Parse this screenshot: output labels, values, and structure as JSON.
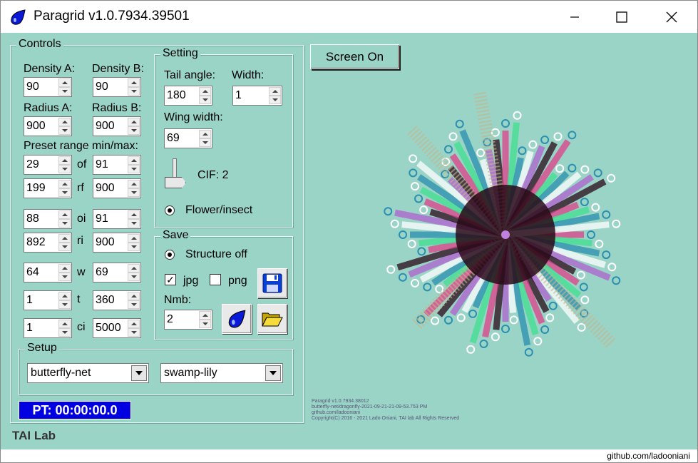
{
  "window": {
    "title": "Paragrid v1.0.7934.39501",
    "min_icon": "minimize-icon",
    "max_icon": "maximize-icon",
    "close_icon": "close-icon"
  },
  "controls": {
    "title": "Controls",
    "density_a_label": "Density A:",
    "density_b_label": "Density B:",
    "density_a": "90",
    "density_b": "90",
    "radius_a_label": "Radius A:",
    "radius_b_label": "Radius B:",
    "radius_a": "900",
    "radius_b": "900",
    "preset_label": "Preset range min/max:",
    "rows": [
      {
        "min": "29",
        "tag": "of",
        "max": "91"
      },
      {
        "min": "199",
        "tag": "rf",
        "max": "900"
      },
      {
        "min": "88",
        "tag": "oi",
        "max": "91"
      },
      {
        "min": "892",
        "tag": "ri",
        "max": "900"
      },
      {
        "min": "64",
        "tag": "w",
        "max": "69"
      },
      {
        "min": "1",
        "tag": "t",
        "max": "360"
      },
      {
        "min": "1",
        "tag": "ci",
        "max": "5000"
      }
    ]
  },
  "setting": {
    "title": "Setting",
    "tail_angle_label": "Tail angle:",
    "tail_angle": "180",
    "width_label": "Width:",
    "width": "1",
    "wing_width_label": "Wing width:",
    "wing_width": "69",
    "cif_label": "CIF: 2",
    "radio_label": "Flower/insect"
  },
  "save": {
    "title": "Save",
    "structure_label": "Structure off",
    "jpg_label": "jpg",
    "jpg_checked": true,
    "png_label": "png",
    "png_checked": false,
    "nmb_label": "Nmb:",
    "nmb": "2",
    "save_icon": "floppy-disk-icon",
    "drop_icon": "blue-drop-icon",
    "folder_icon": "open-folder-icon"
  },
  "setup": {
    "title": "Setup",
    "combo1": "butterfly-net",
    "combo2": "swamp-lily"
  },
  "pt_timer": "PT: 00:00:00.0",
  "footer_lab": "TAI Lab",
  "screen_button": "Screen On",
  "art_meta": [
    "Paragrid v1.0.7934.38012",
    "butterfly-net/dragonfly-2021-09-21-21-09-53.753 PM",
    "github.com/ladooniani",
    "Copyright(C) 2016 - 2021 Lado Oniani, TAI lab All Rights Reserved"
  ],
  "footer_link": "github.com/ladooniani",
  "colors": {
    "background": "#9ad4c6",
    "accent_blue": "#0000e0",
    "art_pink": "#e0408a",
    "art_green": "#40e090",
    "art_teal": "#2a8fb0",
    "art_dark": "#2a0a18"
  }
}
